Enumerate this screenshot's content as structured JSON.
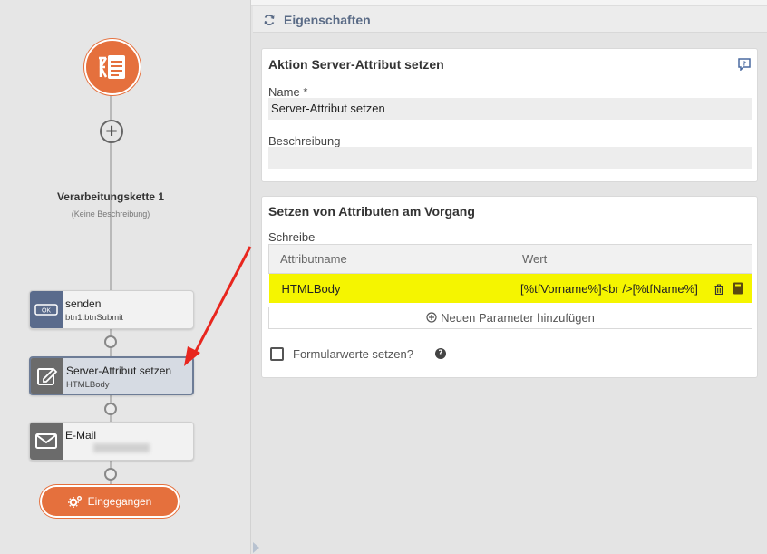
{
  "flow": {
    "chain_title": "Verarbeitungskette 1",
    "chain_description": "(Keine Beschreibung)",
    "nodes": [
      {
        "title": "senden",
        "subtitle": "btn1.btnSubmit",
        "icon": "ok-button-icon",
        "icon_bg": "#5a6b8c"
      },
      {
        "title": "Server-Attribut setzen",
        "subtitle": "HTMLBody",
        "icon": "edit-icon",
        "icon_bg": "#6b6b6b",
        "selected": true
      },
      {
        "title": "E-Mail",
        "subtitle": "",
        "icon": "envelope-icon",
        "icon_bg": "#6b6b6b"
      }
    ],
    "ok_icon_text": "OK",
    "received_button": "Eingegangen"
  },
  "properties": {
    "header_title": "Eigenschaften",
    "action_card": {
      "title": "Aktion Server-Attribut setzen",
      "name_label": "Name",
      "required_mark": "*",
      "name_value": "Server-Attribut setzen",
      "description_label": "Beschreibung",
      "description_value": ""
    },
    "attributes_card": {
      "title": "Setzen von Attributen am Vorgang",
      "write_label": "Schreibe",
      "columns": [
        "Attributname",
        "Wert"
      ],
      "rows": [
        {
          "name": "HTMLBody",
          "value": "[%tfVorname%]<br />[%tfName%]"
        }
      ],
      "add_parameter": "Neuen Parameter hinzufügen",
      "form_values_label": "Formularwerte setzen?"
    }
  },
  "colors": {
    "accent_orange": "#e5703d",
    "highlight_yellow": "#f5f500",
    "header_blue": "#5a6b86",
    "annotation_red": "#e8261e"
  }
}
